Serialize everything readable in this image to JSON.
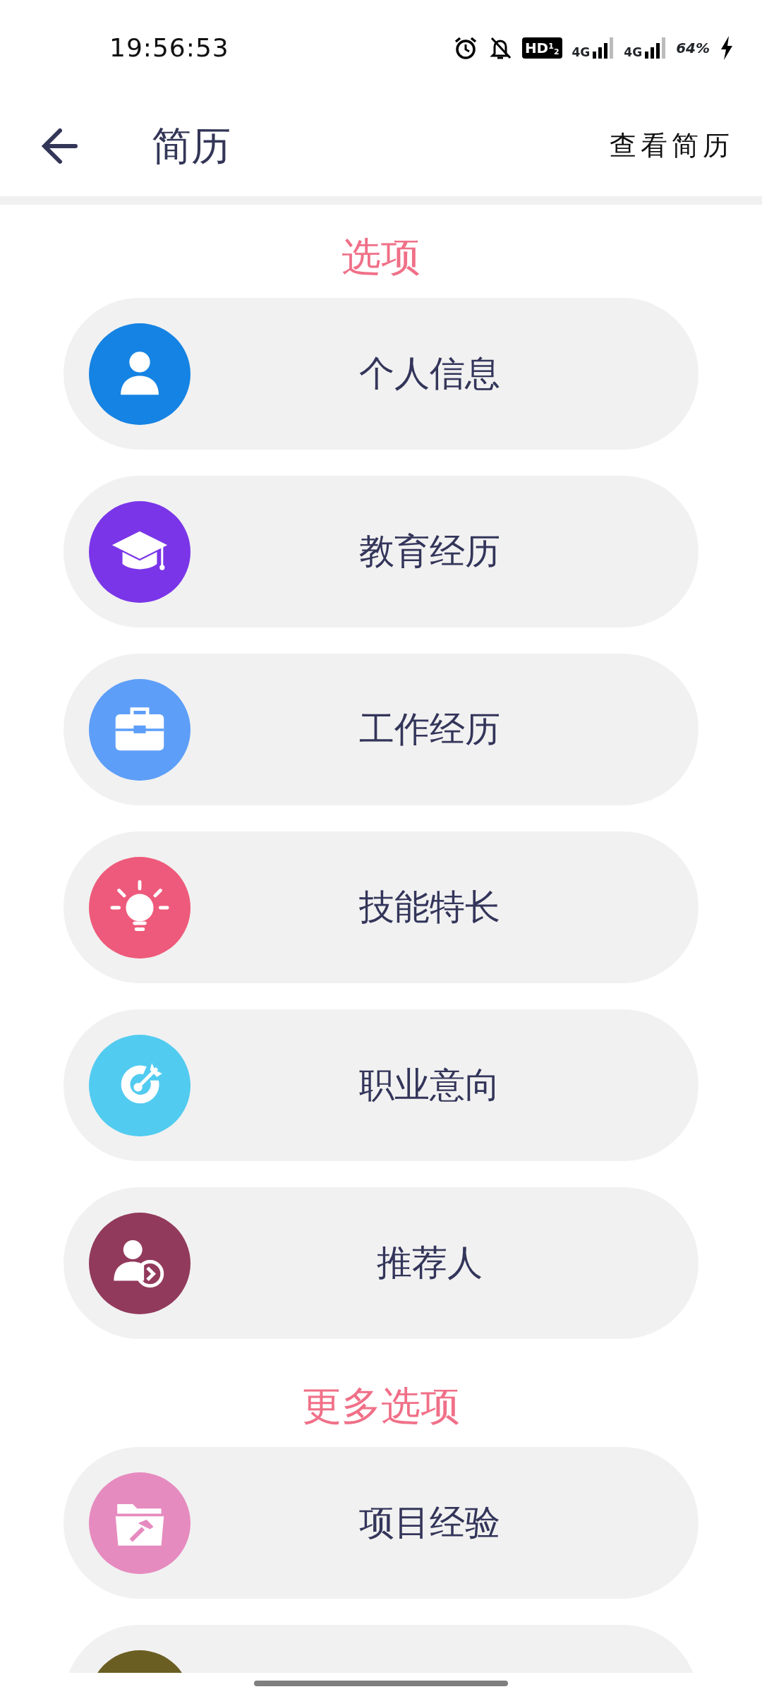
{
  "status_bar": {
    "time": "19:56:53",
    "hd": "HD$^{1}$$_{2}$",
    "network_1": "4G",
    "network_2": "4G",
    "battery": "64%"
  },
  "header": {
    "title": "简历",
    "action": "查看简历"
  },
  "sections": [
    {
      "title": "选项",
      "items": [
        {
          "label": "个人信息",
          "kind": "person",
          "color": "#1583e3"
        },
        {
          "label": "教育经历",
          "kind": "cap",
          "color": "#7a35e8"
        },
        {
          "label": "工作经历",
          "kind": "briefcase",
          "color": "#5d9ef8"
        },
        {
          "label": "技能特长",
          "kind": "bulb",
          "color": "#ee5a7b"
        },
        {
          "label": "职业意向",
          "kind": "target",
          "color": "#52cbf0"
        },
        {
          "label": "推荐人",
          "kind": "referral",
          "color": "#923a5c"
        }
      ]
    },
    {
      "title": "更多选项",
      "items": [
        {
          "label": "项目经验",
          "kind": "folder",
          "color": "#e68bbf"
        },
        {
          "kind": "partial",
          "color": "#6b5e22"
        }
      ]
    }
  ]
}
